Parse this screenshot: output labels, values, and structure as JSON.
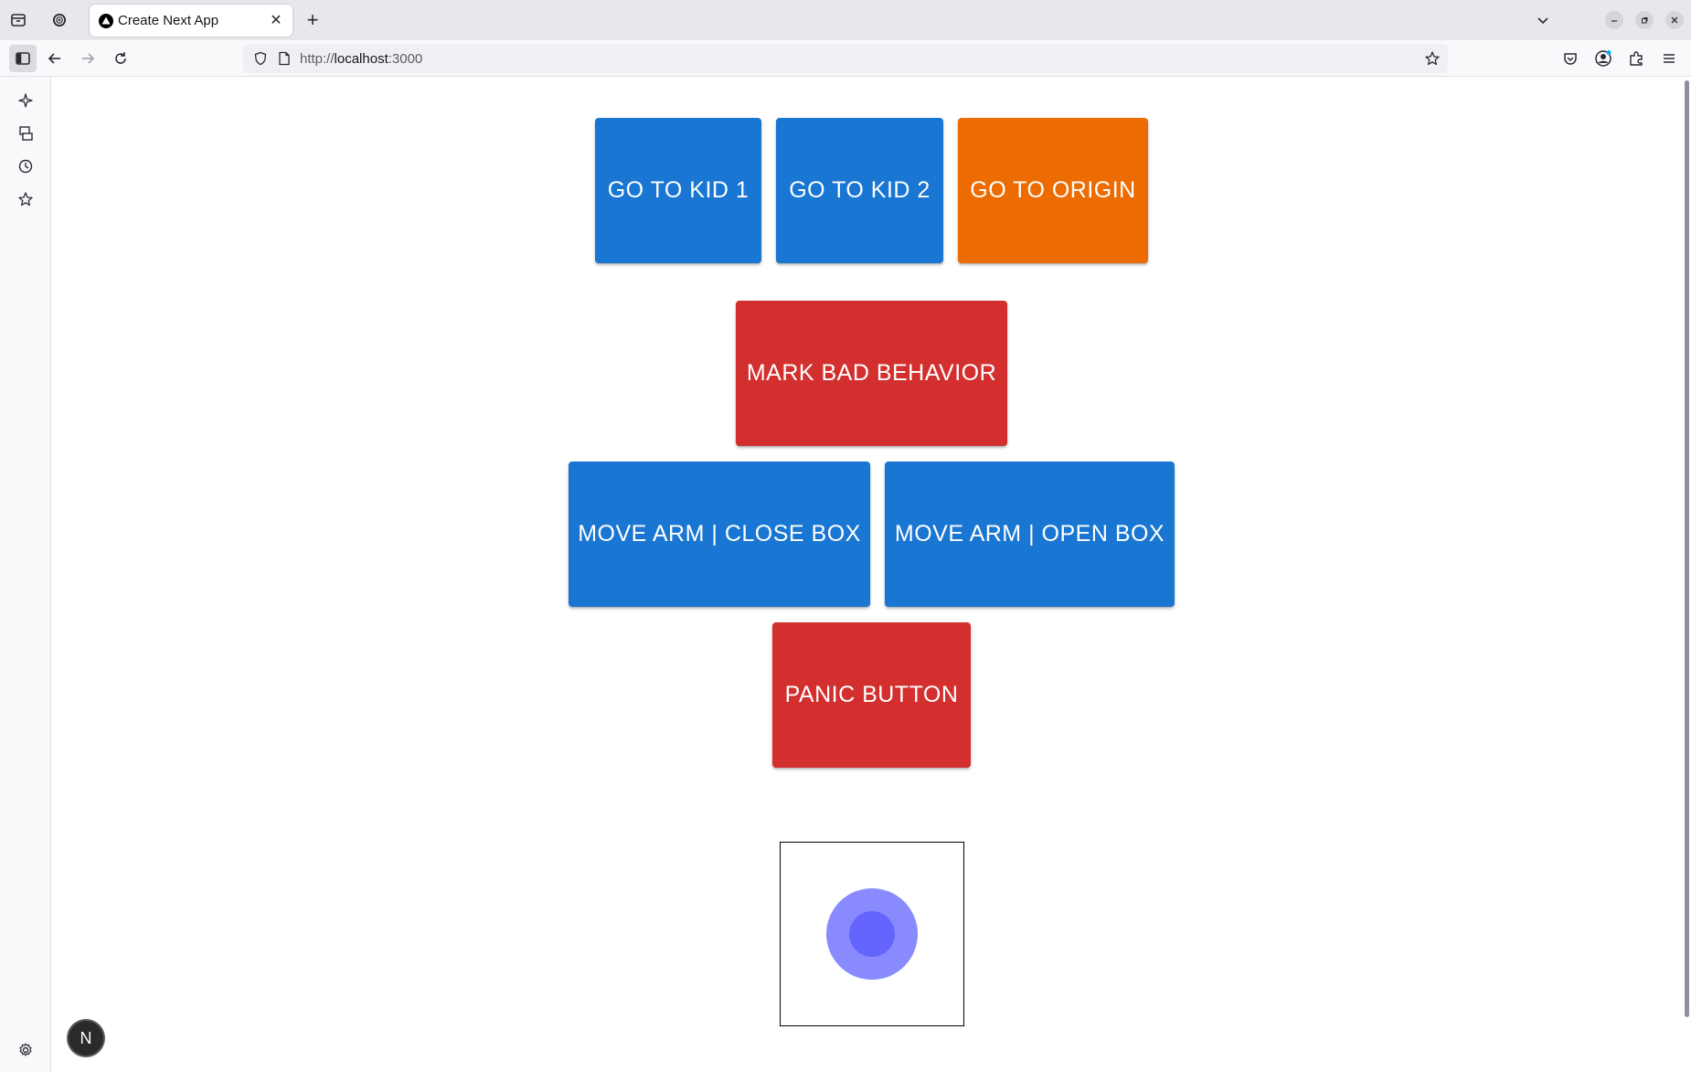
{
  "browser": {
    "tab_title": "Create Next App",
    "tab_close": "✕",
    "new_tab": "+",
    "url_scheme": "http://",
    "url_host": "localhost",
    "url_port": ":3000"
  },
  "controls": {
    "go_to_kid_1": "GO TO KID 1",
    "go_to_kid_2": "GO TO KID 2",
    "go_to_origin": "GO TO ORIGIN",
    "mark_bad_behavior": "MARK BAD BEHAVIOR",
    "move_arm_close_box": "MOVE ARM | CLOSE BOX",
    "move_arm_open_box": "MOVE ARM | OPEN BOX",
    "panic_button": "PANIC BUTTON"
  },
  "joystick": {
    "outer_color": "#8a8aff",
    "inner_color": "#6464ff"
  },
  "dev_badge": {
    "label": "N"
  },
  "colors": {
    "primary": "#1976d2",
    "warning": "#ed6c02",
    "error": "#d32f2f"
  }
}
